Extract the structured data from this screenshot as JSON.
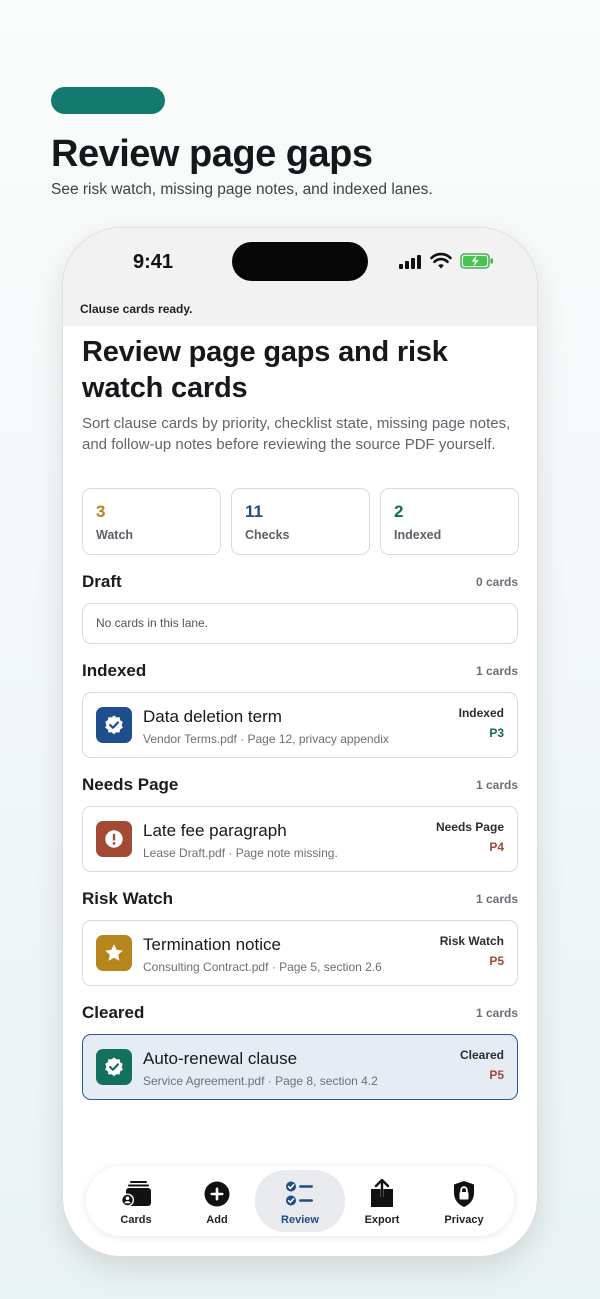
{
  "promo": {
    "title": "Review page gaps",
    "subtitle": "See risk watch, missing page notes, and indexed lanes."
  },
  "status_bar": {
    "time": "9:41",
    "message": "Clause cards ready."
  },
  "header": {
    "title": "Review page gaps and risk watch cards",
    "description": "Sort clause cards by priority, checklist state, missing page notes, and follow-up notes before reviewing the source PDF yourself."
  },
  "stats": [
    {
      "value": "3",
      "label": "Watch",
      "color": "#b5861c"
    },
    {
      "value": "11",
      "label": "Checks",
      "color": "#1f4e86"
    },
    {
      "value": "2",
      "label": "Indexed",
      "color": "#0f6b5c"
    }
  ],
  "sections": {
    "draft": {
      "title": "Draft",
      "count": "0 cards",
      "empty": "No cards in this lane."
    },
    "indexed": {
      "title": "Indexed",
      "count": "1 cards",
      "card": {
        "title": "Data deletion term",
        "sub": "Vendor Terms.pdf · Page 12, privacy appendix",
        "status": "Indexed",
        "priority": "P3",
        "icon": "verified-check-icon",
        "icon_color": "#1f4e8f",
        "priority_color": "#0f6b5c"
      }
    },
    "needs_page": {
      "title": "Needs Page",
      "count": "1 cards",
      "card": {
        "title": "Late fee paragraph",
        "sub": "Lease Draft.pdf · Page note missing.",
        "status": "Needs Page",
        "priority": "P4",
        "icon": "alert-icon",
        "icon_color": "#a24a33",
        "priority_color": "#a24a33"
      }
    },
    "risk_watch": {
      "title": "Risk Watch",
      "count": "1 cards",
      "card": {
        "title": "Termination notice",
        "sub": "Consulting Contract.pdf · Page 5, section 2.6",
        "status": "Risk Watch",
        "priority": "P5",
        "icon": "star-icon",
        "icon_color": "#b5861c",
        "priority_color": "#a24a33"
      }
    },
    "cleared": {
      "title": "Cleared",
      "count": "1 cards",
      "card": {
        "title": "Auto-renewal clause",
        "sub": "Service Agreement.pdf · Page 8, section 4.2",
        "status": "Cleared",
        "priority": "P5",
        "icon": "verified-check-icon",
        "icon_color": "#13705f",
        "priority_color": "#a24a33"
      }
    }
  },
  "tabs": [
    {
      "label": "Cards",
      "icon": "cards-icon"
    },
    {
      "label": "Add",
      "icon": "plus-circle-icon"
    },
    {
      "label": "Review",
      "icon": "checklist-icon",
      "active": true
    },
    {
      "label": "Export",
      "icon": "share-icon"
    },
    {
      "label": "Privacy",
      "icon": "lock-shield-icon"
    }
  ]
}
